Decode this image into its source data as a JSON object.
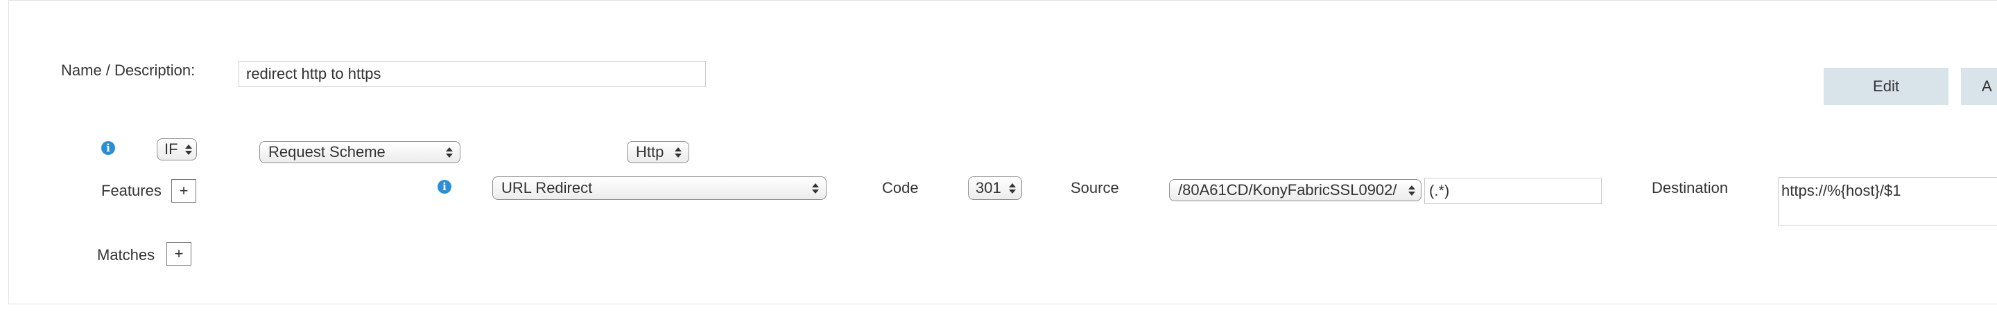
{
  "form": {
    "name_label": "Name / Description:",
    "name_value": "redirect http to https",
    "edit_button": "Edit",
    "second_button": "A"
  },
  "condition": {
    "if_select": "IF",
    "field_select": "Request Scheme",
    "value_select": "Http"
  },
  "features": {
    "label": "Features",
    "add": "+",
    "type_select": "URL Redirect",
    "code_label": "Code",
    "code_select": "301",
    "source_label": "Source",
    "source_select": "/80A61CD/KonyFabricSSL0902/",
    "source_pattern": "(.*)",
    "destination_label": "Destination",
    "destination_value": "https://%{host}/$1"
  },
  "matches": {
    "label": "Matches",
    "add": "+"
  },
  "colors": {
    "info_icon": "#2b8ed6",
    "button_bg": "#d9e3ea"
  }
}
